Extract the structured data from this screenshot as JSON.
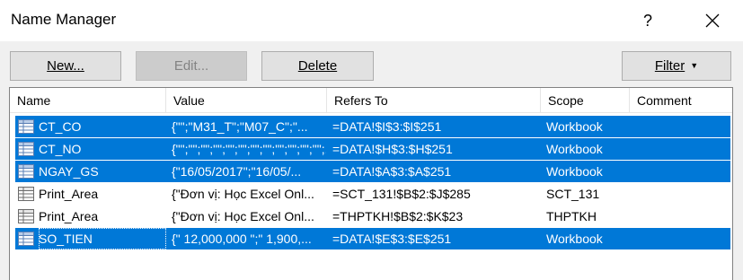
{
  "window": {
    "title": "Name Manager",
    "help_label": "?"
  },
  "toolbar": {
    "new_label": "New...",
    "edit_label": "Edit...",
    "delete_label": "Delete",
    "filter_label": "Filter"
  },
  "columns": [
    "Name",
    "Value",
    "Refers To",
    "Scope",
    "Comment"
  ],
  "rows": [
    {
      "name": "CT_CO",
      "value": "{\"\";\"M31_T\";\"M07_C\";\"...",
      "refers_to": "=DATA!$I$3:$I$251",
      "scope": "Workbook",
      "comment": "",
      "selected": true
    },
    {
      "name": "CT_NO",
      "value": "{\"\";\"\";\"\";\"\";\"\";\"\";\"\";\"\";\"\";\"\";\"\";\"\";...",
      "refers_to": "=DATA!$H$3:$H$251",
      "scope": "Workbook",
      "comment": "",
      "selected": true
    },
    {
      "name": "NGAY_GS",
      "value": "{\"16/05/2017\";\"16/05/...",
      "refers_to": "=DATA!$A$3:$A$251",
      "scope": "Workbook",
      "comment": "",
      "selected": true
    },
    {
      "name": "Print_Area",
      "value": "{\"Đơn vị: Học Excel Onl...",
      "refers_to": "=SCT_131!$B$2:$J$285",
      "scope": "SCT_131",
      "comment": "",
      "selected": false
    },
    {
      "name": "Print_Area",
      "value": "{\"Đơn vị: Học Excel Onl...",
      "refers_to": "=THPTKH!$B$2:$K$23",
      "scope": "THPTKH",
      "comment": "",
      "selected": false
    },
    {
      "name": "SO_TIEN",
      "value": "{\" 12,000,000 \";\" 1,900,...",
      "refers_to": "=DATA!$E$3:$E$251",
      "scope": "Workbook",
      "comment": "",
      "selected": true
    }
  ],
  "colors": {
    "selection": "#0078d7",
    "window_bg": "#f0f0f0"
  }
}
